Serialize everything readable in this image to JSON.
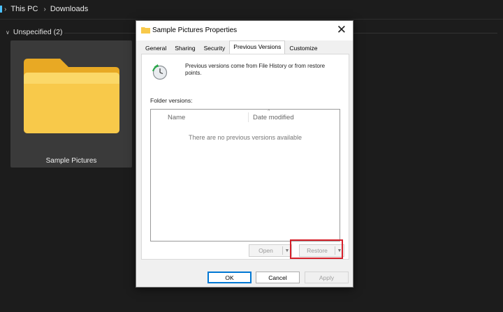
{
  "explorer": {
    "breadcrumb": [
      "This PC",
      "Downloads"
    ],
    "group_header": "Unspecified (2)",
    "tile_label": "Sample Pictures"
  },
  "dialog": {
    "title": "Sample Pictures Properties",
    "tabs": [
      {
        "label": "General"
      },
      {
        "label": "Sharing"
      },
      {
        "label": "Security"
      },
      {
        "label": "Previous Versions",
        "active": true
      },
      {
        "label": "Customize"
      }
    ],
    "info_text": "Previous versions come from File History or from restore points.",
    "folder_versions_label": "Folder versions:",
    "columns": [
      "Name",
      "Date modified"
    ],
    "empty_message": "There are no previous versions available",
    "open_label": "Open",
    "restore_label": "Restore",
    "ok_label": "OK",
    "cancel_label": "Cancel",
    "apply_label": "Apply"
  },
  "colors": {
    "accent": "#0078d4",
    "highlight": "#d6202a",
    "folder": "#f8c94a"
  }
}
